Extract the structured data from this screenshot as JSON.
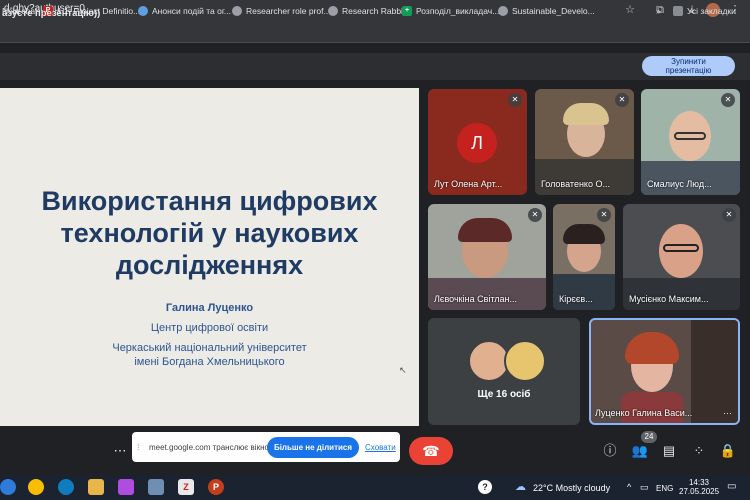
{
  "browser": {
    "url_fragment": "d-qhy?authuser=0",
    "bookmarks": [
      {
        "label": "New chat"
      },
      {
        "label": "1.1: Project Definitio..."
      },
      {
        "label": "Анонси подій та ог..."
      },
      {
        "label": "Researcher role prof..."
      },
      {
        "label": "Research Rabbit"
      },
      {
        "label": "Розподіл_викладач..."
      },
      {
        "label": "Sustainable_Develo..."
      }
    ],
    "all_bookmarks": "Усі закладки"
  },
  "presenting": {
    "text": "азуєте презентацію))",
    "stop_label_1": "Зупинити",
    "stop_label_2": "презентацію"
  },
  "slide": {
    "title_1": "Використання цифрових",
    "title_2": "технологій у наукових",
    "title_3": "дослідженнях",
    "author": "Галина Луценко",
    "center": "Центр цифрової освіти",
    "uni_1": "Черкаський національний університет",
    "uni_2": "імені Богдана Хмельницького"
  },
  "participants": {
    "p1": {
      "name": "Лут Олена Арт...",
      "initial": "Л"
    },
    "p2": {
      "name": "Головатенко О..."
    },
    "p3": {
      "name": "Смалиус Люд..."
    },
    "p4": {
      "name": "Лєвочкіна Світлан..."
    },
    "p5": {
      "name": "Кірєєв..."
    },
    "p6": {
      "name": "Мусієнко Максим..."
    },
    "more": "Ще 16 осіб",
    "self": {
      "name": "Луценко Галина Васи..."
    }
  },
  "share": {
    "text": "meet.google.com транслює вікно.",
    "stop": "Більше не ділитися",
    "cancel": "Сховати"
  },
  "controls": {
    "people_count": "24"
  },
  "taskbar": {
    "weather": "22°C  Mostly cloudy",
    "lang": "ENG",
    "time": "14:33",
    "date": "27.05.2025"
  },
  "colors": {
    "accent": "#1a73e8",
    "hangup": "#ea4335",
    "slide_title": "#1f3b63",
    "avatar_l": "#c5221f"
  }
}
